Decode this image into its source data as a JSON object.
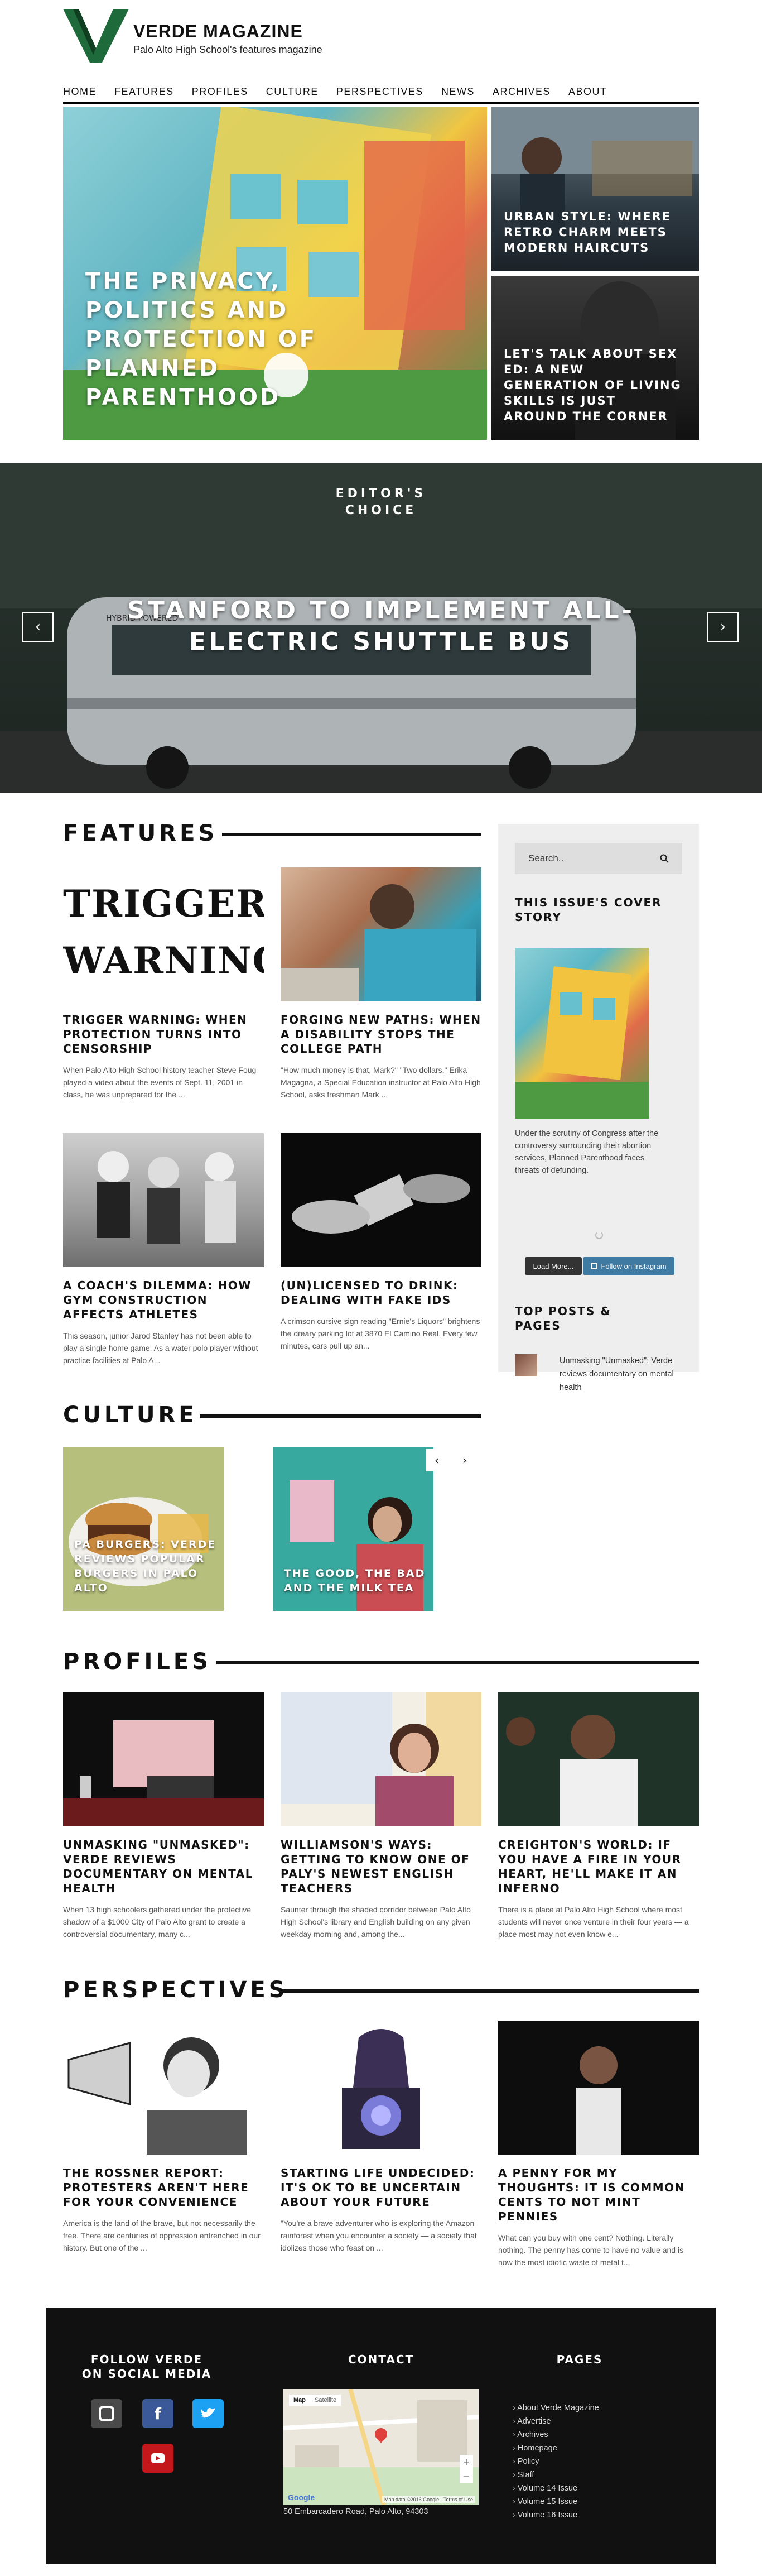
{
  "site": {
    "name": "VERDE MAGAZINE",
    "tagline": "Palo Alto High School's features magazine",
    "accent": "#1f6a3b"
  },
  "nav": [
    "HOME",
    "FEATURES",
    "PROFILES",
    "CULTURE",
    "PERSPECTIVES",
    "NEWS",
    "ARCHIVES",
    "ABOUT"
  ],
  "hero": {
    "main_title": "THE PRIVACY, POLITICS AND PROTECTION OF PLANNED PARENTHOOD",
    "side": [
      {
        "title": "URBAN STYLE: WHERE RETRO CHARM MEETS MODERN HAIRCUTS"
      },
      {
        "title": "LET'S TALK ABOUT SEX ED: A NEW GENERATION OF LIVING SKILLS IS JUST AROUND THE CORNER"
      }
    ]
  },
  "editors": {
    "label_1": "EDITOR'S",
    "label_2": "CHOICE",
    "headline": "STANFORD TO IMPLEMENT ALL-ELECTRIC SHUTTLE BUS",
    "bus_text": "HYBRID POWERED"
  },
  "features": {
    "heading": "FEATURES",
    "cards": [
      {
        "image_text_1": "TRIGGER",
        "image_text_2": "WARNING",
        "title": "TRIGGER WARNING: WHEN PROTECTION TURNS INTO CENSORSHIP",
        "excerpt": "When Palo Alto High School history teacher Steve Foug played a video about the events of Sept. 11, 2001 in class, he was unprepared for the ..."
      },
      {
        "title": "FORGING NEW PATHS: WHEN A DISABILITY STOPS THE COLLEGE PATH",
        "excerpt": "\"How much money is that, Mark?\" \"Two dollars.\" Erika Magagna, a Special Education instructor at Palo Alto High School, asks freshman Mark ..."
      },
      {
        "title": "A COACH'S DILEMMA: HOW GYM CONSTRUCTION AFFECTS ATHLETES",
        "excerpt": "This season, junior Jarod Stanley has not been able to play a single home game. As a water polo player without practice facilities at Palo A..."
      },
      {
        "title": "(UN)LICENSED TO DRINK: DEALING WITH FAKE IDS",
        "excerpt": "A crimson cursive sign reading \"Ernie's Liquors\" brightens the dreary parking lot at 3870 El Camino Real. Every few minutes, cars pull up an..."
      }
    ]
  },
  "sidebar": {
    "search_placeholder": "Search..",
    "cover_heading": "THIS ISSUE'S COVER STORY",
    "cover_caption": "Under the scrutiny of Congress after the controversy surrounding their abortion services, Planned Parenthood faces threats of defunding.",
    "load_more": "Load More...",
    "follow_instagram": "Follow on Instagram",
    "top_posts_heading": "TOP POSTS & PAGES",
    "top_post": "Unmasking \"Unmasked\": Verde reviews documentary on mental health"
  },
  "culture": {
    "heading": "CULTURE",
    "slides": [
      {
        "title": "PA BURGERS: VERDE REVIEWS POPULAR BURGERS IN PALO ALTO"
      },
      {
        "title": "THE GOOD, THE BAD AND THE MILK TEA"
      }
    ]
  },
  "profiles": {
    "heading": "PROFILES",
    "cards": [
      {
        "title": "UNMASKING \"UNMASKED\": VERDE REVIEWS DOCUMENTARY ON MENTAL HEALTH",
        "excerpt": "When 13 high schoolers gathered under the protective shadow of a $1000 City of Palo Alto grant to create a controversial documentary, many c..."
      },
      {
        "title": "WILLIAMSON'S WAYS: GETTING TO KNOW ONE OF PALY'S NEWEST ENGLISH TEACHERS",
        "excerpt": "Saunter through the shaded corridor between Palo Alto High School's library and English building on any given weekday morning and, among the..."
      },
      {
        "title": "CREIGHTON'S WORLD: IF YOU HAVE A FIRE IN YOUR HEART, HE'LL MAKE IT AN INFERNO",
        "excerpt": "There is a place at Palo Alto High School where most students will never once venture in their four years — a place most may not even know e..."
      }
    ]
  },
  "perspectives": {
    "heading": "PERSPECTIVES",
    "cards": [
      {
        "title": "THE ROSSNER REPORT: PROTESTERS AREN'T HERE FOR YOUR CONVENIENCE",
        "excerpt": "America is the land of the brave, but not necessarily the free. There are centuries of oppression entrenched in our history. But one of the ..."
      },
      {
        "title": "STARTING LIFE UNDECIDED: IT'S OK TO BE UNCERTAIN ABOUT YOUR FUTURE",
        "excerpt": "\"You're a brave adventurer who is exploring the Amazon rainforest when you encounter a society — a society that idolizes those who feast on ..."
      },
      {
        "title": "A PENNY FOR MY THOUGHTS: IT IS COMMON CENTS TO NOT MINT PENNIES",
        "excerpt": "What can you buy with one cent? Nothing. Literally nothing. The penny has come to have no value and is now the most idiotic waste of metal t..."
      }
    ]
  },
  "footer": {
    "follow_heading": "FOLLOW VERDE ON SOCIAL MEDIA",
    "contact_heading": "CONTACT",
    "pages_heading": "PAGES",
    "address": "50 Embarcadero Road, Palo Alto, 94303",
    "map_tab_map": "Map",
    "map_tab_sat": "Satellite",
    "map_brand": "Google",
    "map_footer": "Map data ©2016 Google · Terms of Use",
    "pages": [
      "About Verde Magazine",
      "Advertise",
      "Archives",
      "Homepage",
      "Policy",
      "Staff",
      "Volume 14 Issue",
      "Volume 15 Issue",
      "Volume 16 Issue"
    ]
  }
}
